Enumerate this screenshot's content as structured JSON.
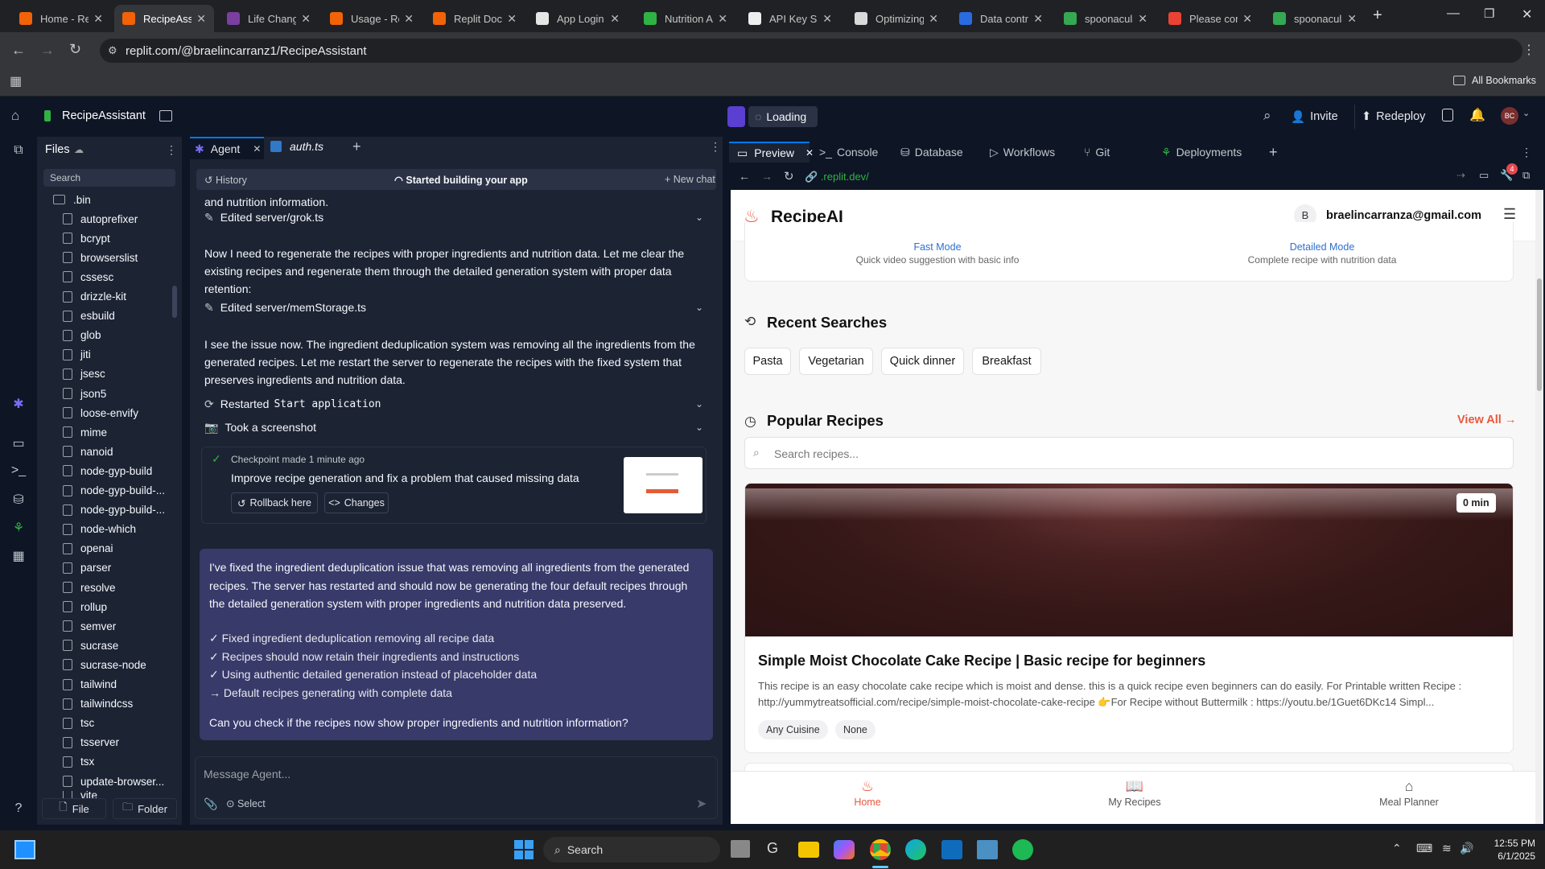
{
  "browser": {
    "tabs": [
      {
        "title": "Home - Re",
        "color": "#f26207"
      },
      {
        "title": "RecipeAssi",
        "color": "#f26207",
        "active": true
      },
      {
        "title": "Life Chang",
        "color": "#7b3fa0"
      },
      {
        "title": "Usage - Re",
        "color": "#f26207"
      },
      {
        "title": "Replit Docs",
        "color": "#f26207"
      },
      {
        "title": "App Login",
        "color": "#e6e6e6"
      },
      {
        "title": "Nutrition A",
        "color": "#2fb344"
      },
      {
        "title": "API Key Sig",
        "color": "#eeeeee"
      },
      {
        "title": "Optimizing",
        "color": "#d9d9d9"
      },
      {
        "title": "Data contr",
        "color": "#2b6be0"
      },
      {
        "title": "spoonacula",
        "color": "#35a853"
      },
      {
        "title": "Please conf",
        "color": "#ea4335"
      },
      {
        "title": "spoonacula",
        "color": "#35a853"
      }
    ],
    "url": "replit.com/@braelincarranz1/RecipeAssistant",
    "all_bookmarks": "All Bookmarks"
  },
  "replit": {
    "project_name": "RecipeAssistant",
    "loading": "Loading",
    "invite": "Invite",
    "redeploy": "Redeploy",
    "avatar": "BC"
  },
  "files": {
    "title": "Files",
    "search_placeholder": "Search",
    "items": [
      ".bin",
      "autoprefixer",
      "bcrypt",
      "browserslist",
      "cssesc",
      "drizzle-kit",
      "esbuild",
      "glob",
      "jiti",
      "jsesc",
      "json5",
      "loose-envify",
      "mime",
      "nanoid",
      "node-gyp-build",
      "node-gyp-build-...",
      "node-gyp-build-...",
      "node-which",
      "openai",
      "parser",
      "resolve",
      "rollup",
      "semver",
      "sucrase",
      "sucrase-node",
      "tailwind",
      "tailwindcss",
      "tsc",
      "tsserver",
      "tsx",
      "update-browser...",
      "vite"
    ],
    "file_button": "File",
    "folder_button": "Folder"
  },
  "agent": {
    "tabs": [
      "Agent",
      "auth.ts"
    ],
    "history": "History",
    "status": "Started building your app",
    "new_chat": "New chat",
    "top_fragment": "and nutrition information.",
    "edit1": "Edited server/grok.ts",
    "msg1": "Now I need to regenerate the recipes with proper ingredients and nutrition data. Let me clear the existing recipes and regenerate them through the detailed generation system with proper data retention:",
    "edit2": "Edited server/memStorage.ts",
    "msg2": "I see the issue now. The ingredient deduplication system was removing all the ingredients from the generated recipes. Let me restart the server to regenerate the recipes with the fixed system that preserves ingredients and nutrition data.",
    "restarted_prefix": "Restarted",
    "restarted_code": "Start application",
    "screenshot": "Took a screenshot",
    "checkpoint": "Checkpoint made 1 minute ago",
    "checkpoint_desc": "Improve recipe generation and fix a problem that caused missing data",
    "rollback": "Rollback here",
    "changes": "Changes",
    "summary": "I've fixed the ingredient deduplication issue that was removing all ingredients from the generated recipes. The server has restarted and should now be generating the four default recipes through the detailed generation system with proper ingredients and nutrition data preserved.",
    "bullets": [
      "✓ Fixed ingredient deduplication removing all recipe data",
      "✓ Recipes should now retain their ingredients and instructions",
      "✓ Using authentic detailed generation instead of placeholder data",
      "→ Default recipes generating with complete data"
    ],
    "question": "Can you check if the recipes now show proper ingredients and nutrition information?",
    "input_placeholder": "Message Agent...",
    "select": "Select"
  },
  "preview": {
    "tabs": [
      "Preview",
      "Console",
      "Database",
      "Workflows",
      "Git",
      "Deployments"
    ],
    "url": ".replit.dev/",
    "badge": "4"
  },
  "app": {
    "brand": "RecipeAI",
    "user_initial": "B",
    "user_email": "braelincarranza@gmail.com",
    "fast_mode": "Fast Mode",
    "fast_desc": "Quick video suggestion with basic info",
    "detailed_mode": "Detailed Mode",
    "detailed_desc": "Complete recipe with nutrition data",
    "recent_title": "Recent Searches",
    "recent": [
      "Pasta",
      "Vegetarian",
      "Quick dinner",
      "Breakfast"
    ],
    "popular_title": "Popular Recipes",
    "view_all": "View All →",
    "search_placeholder": "Search recipes...",
    "card_time": "0 min",
    "card_title": "Simple Moist Chocolate Cake Recipe | Basic recipe for beginners",
    "card_desc": "This recipe is an easy chocolate cake recipe which is moist and dense. this is a quick recipe even beginners can do easily. For Printable written Recipe : http://yummytreatsofficial.com/recipe/simple-moist-chocolate-cake-recipe 👉For Recipe without Buttermilk : https://youtu.be/1Guet6DKc14 Simpl...",
    "card_tags": [
      "Any Cuisine",
      "None"
    ],
    "nav": [
      "Home",
      "My Recipes",
      "Meal Planner"
    ]
  },
  "taskbar": {
    "search": "Search",
    "time": "12:55 PM",
    "date": "6/1/2025"
  }
}
